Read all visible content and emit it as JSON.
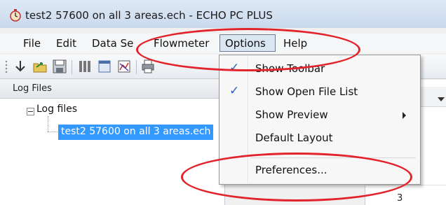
{
  "window": {
    "title": "test2 57600 on all 3 areas.ech - ECHO PC PLUS",
    "app_icon": "stopwatch-icon"
  },
  "menubar": {
    "items": [
      "File",
      "Edit",
      "Data Se",
      "Flowmeter",
      "Options",
      "Help"
    ],
    "active": "Options"
  },
  "toolbar": {
    "icons": [
      "arrow-down-icon",
      "open-folder-icon",
      "save-icon",
      "columns-icon",
      "window-icon",
      "chart-icon",
      "printer-icon"
    ]
  },
  "log_panel": {
    "title": "Log Files",
    "tree": {
      "root": "Log files",
      "children": [
        "test2 57600 on all 3 areas.ech"
      ]
    }
  },
  "right_panel": {
    "header_fragment": "t",
    "cell_value": "3"
  },
  "options_menu": {
    "items": [
      {
        "label": "Show Toolbar",
        "checked": true
      },
      {
        "label": "Show Open File List",
        "checked": true
      },
      {
        "label": "Show Preview",
        "checked": false,
        "submenu": true
      },
      {
        "label": "Default Layout",
        "checked": false
      },
      {
        "label": "Preferences...",
        "checked": false
      }
    ],
    "check_glyph": "✓"
  },
  "annotations": {
    "color": "#e3232b"
  }
}
